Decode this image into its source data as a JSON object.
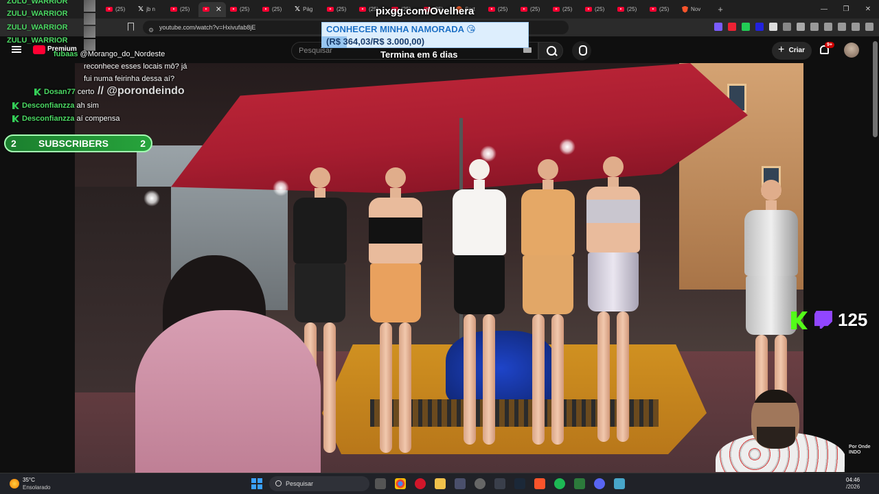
{
  "browser": {
    "tabs": [
      {
        "icon": "youtube-icon",
        "label": "(25)"
      },
      {
        "icon": "x-icon",
        "label": "jb n"
      },
      {
        "icon": "youtube-icon",
        "label": "(25)"
      },
      {
        "icon": "youtube-icon",
        "label": ""
      },
      {
        "icon": "youtube-icon",
        "label": "(25)"
      },
      {
        "icon": "youtube-icon",
        "label": "(25)"
      },
      {
        "icon": "x-icon",
        "label": "Pág"
      },
      {
        "icon": "youtube-icon",
        "label": "(25)"
      },
      {
        "icon": "youtube-icon",
        "label": "(25)"
      },
      {
        "icon": "youtube-icon",
        "label": "(25)"
      },
      {
        "icon": "youtube-icon",
        "label": "(25)"
      },
      {
        "icon": "orange-circle-icon",
        "label": "Sort"
      },
      {
        "icon": "youtube-icon",
        "label": "(25)"
      },
      {
        "icon": "youtube-icon",
        "label": "(25)"
      },
      {
        "icon": "youtube-icon",
        "label": "(25)"
      },
      {
        "icon": "youtube-icon",
        "label": "(25)"
      },
      {
        "icon": "youtube-icon",
        "label": "(25)"
      },
      {
        "icon": "youtube-icon",
        "label": "(25)"
      },
      {
        "icon": "brave-icon",
        "label": "Nov"
      }
    ],
    "url": "youtube.com/watch?v=Hxivufab8jE"
  },
  "youtube": {
    "premium_label": "Premium",
    "search_placeholder": "Pesquisar",
    "create_label": "Criar",
    "notifications": "9+"
  },
  "overlay": {
    "pix_url": "pixgg.com/Ovelhera",
    "goal_title": "CONHECER MINHA NAMORADA 😘",
    "goal_progress": "(R$ 364,03/R$ 3.000,00)",
    "goal_fraction": 0.121,
    "timer": "Termina em 6 dias",
    "watermark": "// @porondeindo",
    "subs_left": "2",
    "subs_label": "SUBSCRIBERS",
    "subs_right": "2",
    "viewer_count": "125",
    "channel_tag": "Por Onde INDO"
  },
  "chat": {
    "zulu_lines": [
      "ZULU_WARRIOR",
      "ZULU_WARRIOR",
      "ZULU_WARRIOR",
      "ZULU_WARRIOR"
    ],
    "messages": [
      {
        "user": "fubaas",
        "text": "@Morango_do_Nordeste"
      },
      {
        "user": "",
        "text": "reconhece esses locais mô? já"
      },
      {
        "user": "",
        "text": "fui numa feirinha dessa aí?"
      },
      {
        "user": "Dosan77",
        "text": "certo"
      },
      {
        "user": "Desconfianzza",
        "text": "ah sim"
      },
      {
        "user": "Desconfianzza",
        "text": "aí compensa"
      }
    ]
  },
  "taskbar": {
    "temperature": "35°C",
    "weather": "Ensolarado",
    "search_label": "Pesquisar",
    "time": "04:46",
    "date": "/2026"
  },
  "colors": {
    "kick_green": "#53fc18",
    "twitch_purple": "#9146ff",
    "youtube_red": "#ff0033"
  }
}
